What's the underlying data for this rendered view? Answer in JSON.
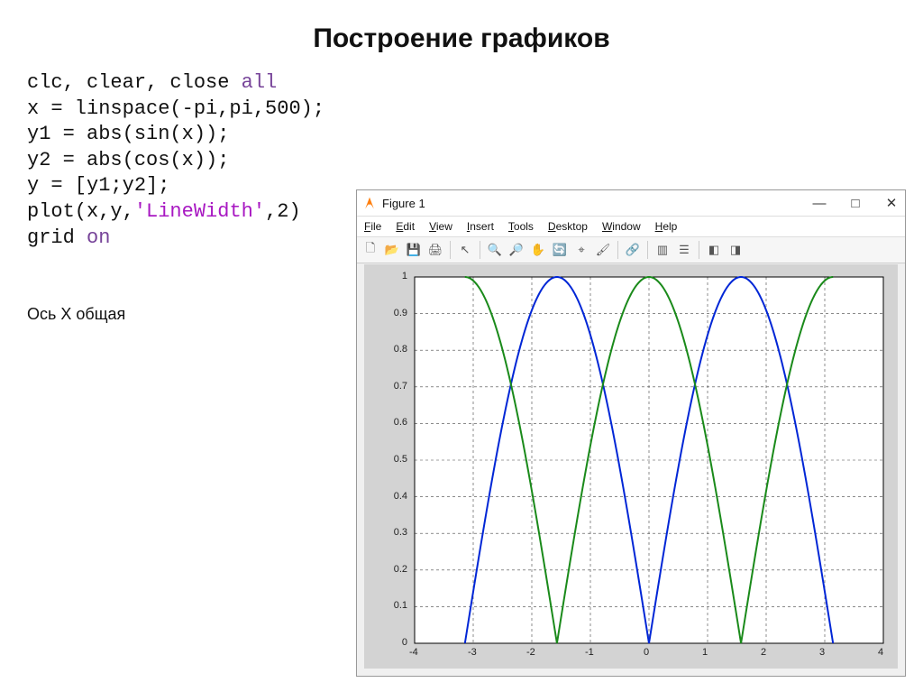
{
  "page_title": "Построение графиков",
  "code_lines": [
    {
      "plain": "clc, clear, close ",
      "kw": "all"
    },
    {
      "plain": "x = linspace(-pi,pi,500);"
    },
    {
      "plain": "y1 = abs(sin(x));"
    },
    {
      "plain": "y2 = abs(cos(x));"
    },
    {
      "plain": "y = [y1;y2];"
    },
    {
      "plain": "plot(x,y,",
      "str": "'LineWidth'",
      "tail": ",2)"
    },
    {
      "plain": "grid ",
      "kw": "on"
    }
  ],
  "note": "Ось X общая",
  "figure": {
    "title": "Figure 1",
    "window_buttons": {
      "min": "—",
      "max": "□",
      "close": "✕"
    },
    "menus": [
      "File",
      "Edit",
      "View",
      "Insert",
      "Tools",
      "Desktop",
      "Window",
      "Help"
    ],
    "toolbar_icons": [
      "new-file-icon",
      "open-icon",
      "save-icon",
      "print-icon",
      "|",
      "arrow-icon",
      "|",
      "zoom-in-icon",
      "zoom-out-icon",
      "pan-icon",
      "rotate-icon",
      "data-cursor-icon",
      "brush-icon",
      "|",
      "link-icon",
      "|",
      "colorbar-icon",
      "legend-icon",
      "|",
      "dock-icon",
      "undock-icon"
    ]
  },
  "chart_data": {
    "type": "line",
    "x_range": [
      -3.1416,
      3.1416
    ],
    "xlim": [
      -4,
      4
    ],
    "ylim": [
      0,
      1
    ],
    "x_ticks": [
      -4,
      -3,
      -2,
      -1,
      0,
      1,
      2,
      3,
      4
    ],
    "y_ticks": [
      0,
      0.1,
      0.2,
      0.3,
      0.4,
      0.5,
      0.6,
      0.7,
      0.8,
      0.9,
      1
    ],
    "grid": true,
    "series": [
      {
        "name": "abs(sin(x))",
        "color": "#0026d6",
        "formula": "abs(sin(x))"
      },
      {
        "name": "abs(cos(x))",
        "color": "#1a8a1a",
        "formula": "abs(cos(x))"
      }
    ],
    "title": "",
    "xlabel": "",
    "ylabel": ""
  }
}
